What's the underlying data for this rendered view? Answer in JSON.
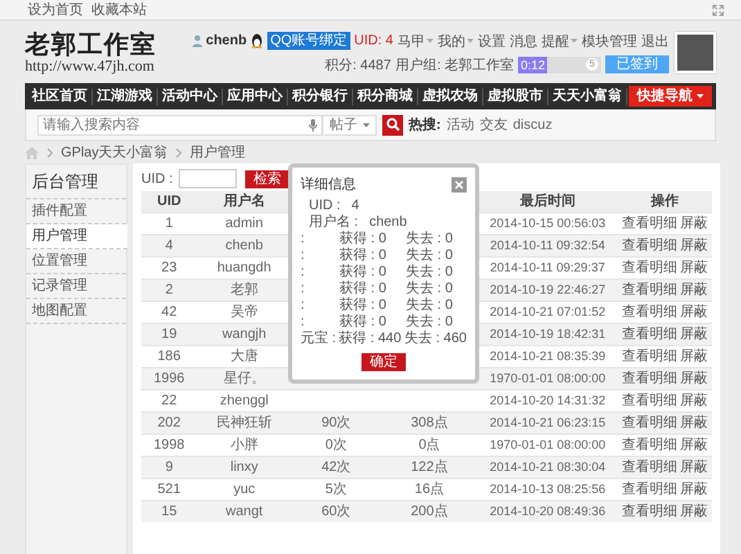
{
  "topbar": {
    "links": [
      "设为首页",
      "收藏本站"
    ]
  },
  "logo": {
    "title": "老郭工作室",
    "url": "http://www.47jh.com"
  },
  "user": {
    "name": "chenb",
    "qq_button": "QQ账号绑定",
    "uid": "UID: 4",
    "menu": [
      {
        "label": "马甲",
        "dropdown": true
      },
      {
        "label": "我的",
        "dropdown": true
      },
      {
        "label": "设置",
        "dropdown": false
      },
      {
        "label": "消息",
        "dropdown": false
      },
      {
        "label": "提醒",
        "dropdown": true
      },
      {
        "label": "模块管理",
        "dropdown": false
      },
      {
        "label": "退出",
        "dropdown": false
      }
    ],
    "points": "积分: 4487",
    "group": "用户组: 老郭工作室",
    "checkin": {
      "level": 0.35,
      "text": "0:12",
      "count": "5"
    },
    "signed_button": "已签到"
  },
  "nav": {
    "items": [
      "社区首页",
      "江湖游戏",
      "活动中心",
      "应用中心",
      "积分银行",
      "积分商城",
      "虚拟农场",
      "虚拟股市",
      "天天小富翁"
    ],
    "quick": "快捷导航"
  },
  "search": {
    "placeholder": "请输入搜索内容",
    "scope": "帖子",
    "hot_label": "热搜:",
    "hot": [
      "活动",
      "交友",
      "discuz"
    ]
  },
  "breadcrumb": [
    "GPlay天天小富翁",
    "用户管理"
  ],
  "sidebar": {
    "title": "后台管理",
    "items": [
      {
        "label": "插件配置",
        "selected": false
      },
      {
        "label": "用户管理",
        "selected": true
      },
      {
        "label": "位置管理",
        "selected": false
      },
      {
        "label": "记录管理",
        "selected": false
      },
      {
        "label": "地图配置",
        "selected": false
      }
    ]
  },
  "filter": {
    "label": "UID :",
    "button": "检索"
  },
  "table": {
    "columns": [
      {
        "label": "UID"
      },
      {
        "label": "用户名"
      },
      {},
      {},
      {
        "label": "最后时间"
      },
      {
        "label": "操作"
      }
    ],
    "rows": [
      {
        "uid": "1",
        "name": "admin",
        "time": "2014-10-15 00:56:03",
        "actions": [
          "查看明细",
          "屏蔽"
        ]
      },
      {
        "uid": "4",
        "name": "chenb",
        "time": "2014-10-11 09:32:54",
        "actions": [
          "查看明细",
          "屏蔽"
        ]
      },
      {
        "uid": "23",
        "name": "huangdh",
        "time": "2014-10-11 09:29:37",
        "actions": [
          "查看明细",
          "屏蔽"
        ]
      },
      {
        "uid": "2",
        "name": "老郭",
        "time": "2014-10-19 22:46:27",
        "actions": [
          "查看明细",
          "屏蔽"
        ]
      },
      {
        "uid": "42",
        "name": "吴帝",
        "time": "2014-10-21 07:01:52",
        "actions": [
          "查看明细",
          "屏蔽"
        ]
      },
      {
        "uid": "19",
        "name": "wangjh",
        "time": "2014-10-19 18:42:31",
        "actions": [
          "查看明细",
          "屏蔽"
        ]
      },
      {
        "uid": "186",
        "name": "大唐",
        "time": "2014-10-21 08:35:39",
        "actions": [
          "查看明细",
          "屏蔽"
        ]
      },
      {
        "uid": "1996",
        "name": "星仔。",
        "time": "1970-01-01 08:00:00",
        "actions": [
          "查看明细",
          "屏蔽"
        ]
      },
      {
        "uid": "22",
        "name": "zhenggl",
        "time": "2014-10-20 14:31:32",
        "actions": [
          "查看明细",
          "屏蔽"
        ]
      },
      {
        "uid": "202",
        "name": "民神狂斩",
        "column_3": "90次",
        "column_4": "308点",
        "time": "2014-10-21 06:23:15",
        "actions": [
          "查看明细",
          "屏蔽"
        ]
      },
      {
        "uid": "1998",
        "name": "小胖",
        "column_3": "0次",
        "column_4": "0点",
        "time": "1970-01-01 08:00:00",
        "actions": [
          "查看明细",
          "屏蔽"
        ]
      },
      {
        "uid": "9",
        "name": "linxy",
        "column_3": "42次",
        "column_4": "122点",
        "time": "2014-10-21 08:30:04",
        "actions": [
          "查看明细",
          "屏蔽"
        ]
      },
      {
        "uid": "521",
        "name": "yuc",
        "column_3": "5次",
        "column_4": "16点",
        "time": "2014-10-13 08:25:56",
        "actions": [
          "查看明细",
          "屏蔽"
        ]
      },
      {
        "uid": "15",
        "name": "wangt",
        "column_3": "60次",
        "column_4": "200点",
        "time": "2014-10-20 08:49:36",
        "actions": [
          "查看明细",
          "屏蔽"
        ]
      }
    ]
  },
  "dialog": {
    "title": "详细信息",
    "fields": [
      {
        "label": "UID :",
        "value": "4"
      },
      {
        "label": "用户名 :",
        "value": "chenb"
      }
    ],
    "records": [
      {
        "label": ":",
        "gain": "获得 : 0",
        "loss": "失去 : 0"
      },
      {
        "label": ":",
        "gain": "获得 : 0",
        "loss": "失去 : 0"
      },
      {
        "label": ":",
        "gain": "获得 : 0",
        "loss": "失去 : 0"
      },
      {
        "label": ":",
        "gain": "获得 : 0",
        "loss": "失去 : 0"
      },
      {
        "label": ":",
        "gain": "获得 : 0",
        "loss": "失去 : 0"
      },
      {
        "label": ":",
        "gain": "获得 : 0",
        "loss": "失去 : 0"
      },
      {
        "label": "元宝 :",
        "gain": "获得 : 440",
        "loss": "失去 : 460"
      }
    ],
    "button": "确定"
  }
}
